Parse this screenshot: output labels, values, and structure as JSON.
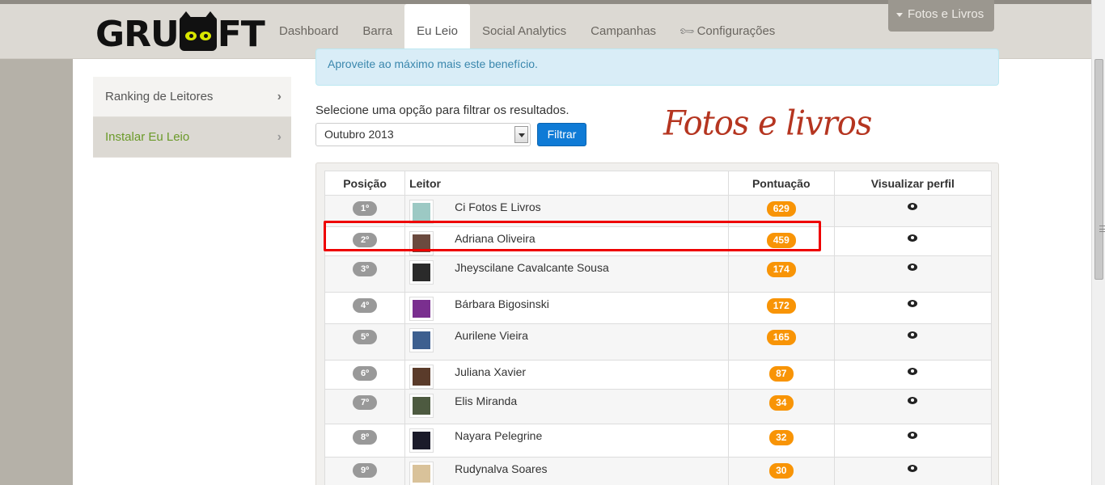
{
  "navbar": {
    "logo_text": "GRUMFT",
    "tabs": [
      {
        "label": "Dashboard"
      },
      {
        "label": "Barra"
      },
      {
        "label": "Eu Leio"
      },
      {
        "label": "Social Analytics"
      },
      {
        "label": "Campanhas"
      },
      {
        "label": "Configurações",
        "icon": "wrench-icon"
      }
    ],
    "user_menu": "Fotos e Livros"
  },
  "sidebar": {
    "items": [
      {
        "label": "Ranking de Leitores"
      },
      {
        "label": "Instalar Eu Leio"
      }
    ]
  },
  "alert": {
    "text": "Aproveite ao máximo mais este benefício."
  },
  "filter": {
    "label": "Selecione uma opção para filtrar os resultados.",
    "selected": "Outubro 2013",
    "button": "Filtrar"
  },
  "brand_signature": "Fotos e livros",
  "table": {
    "headers": {
      "position": "Posição",
      "reader": "Leitor",
      "points": "Pontuação",
      "view": "Visualizar perfil"
    },
    "rows": [
      {
        "pos": "1º",
        "name": "Ci Fotos E Livros",
        "points": "629"
      },
      {
        "pos": "2º",
        "name": "Adriana Oliveira",
        "points": "459"
      },
      {
        "pos": "3º",
        "name": "Jheyscilane Cavalcante Sousa",
        "points": "174"
      },
      {
        "pos": "4º",
        "name": "Bárbara Bigosinski",
        "points": "172"
      },
      {
        "pos": "5º",
        "name": "Aurilene Vieira",
        "points": "165"
      },
      {
        "pos": "6º",
        "name": "Juliana Xavier",
        "points": "87"
      },
      {
        "pos": "7º",
        "name": "Elis Miranda",
        "points": "34"
      },
      {
        "pos": "8º",
        "name": "Nayara Pelegrine",
        "points": "32"
      },
      {
        "pos": "9º",
        "name": "Rudynalva Soares",
        "points": "30"
      }
    ]
  },
  "colors": {
    "accent": "#0f7bd6",
    "points_badge": "#f89406",
    "highlight": "#e00000",
    "active_sidebar_text": "#6b9a2a"
  }
}
